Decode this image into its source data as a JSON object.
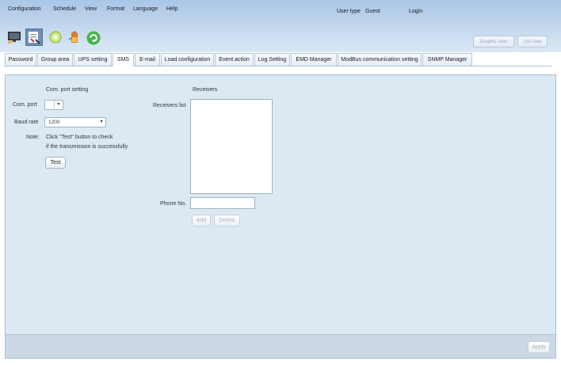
{
  "menu": [
    "Configuration",
    "Schedule",
    "View",
    "Format",
    "Language",
    "Help"
  ],
  "user": {
    "type_label": "User type",
    "type_value": "Guest",
    "login_label": "Login"
  },
  "toolbar": {
    "graphic_view": "Graphic view",
    "list_view": "List view"
  },
  "tabs": [
    "Password",
    "Group area",
    "UPS setting",
    "SMS",
    "E-mail",
    "Load configuration",
    "Event action",
    "Log Setting",
    "EMD Manager",
    "ModBus communication setting",
    "SNMP Manager"
  ],
  "active_tab": "SMS",
  "com": {
    "section_title": "Com. port setting",
    "port_label": "Com. port",
    "port_value": "",
    "baud_label": "Baud rate",
    "baud_value": "1200",
    "note_label": "Note:",
    "note_line1": "Click \"Test\" button to check",
    "note_line2": "if the transmission is successfully",
    "test_button": "Test"
  },
  "receivers": {
    "section_title": "Receivers",
    "list_label": "Receivers list",
    "items": [],
    "phone_label": "Phone No.",
    "phone_value": "",
    "add_button": "Add",
    "delete_button": "Delete"
  },
  "apply_button": "Apply"
}
